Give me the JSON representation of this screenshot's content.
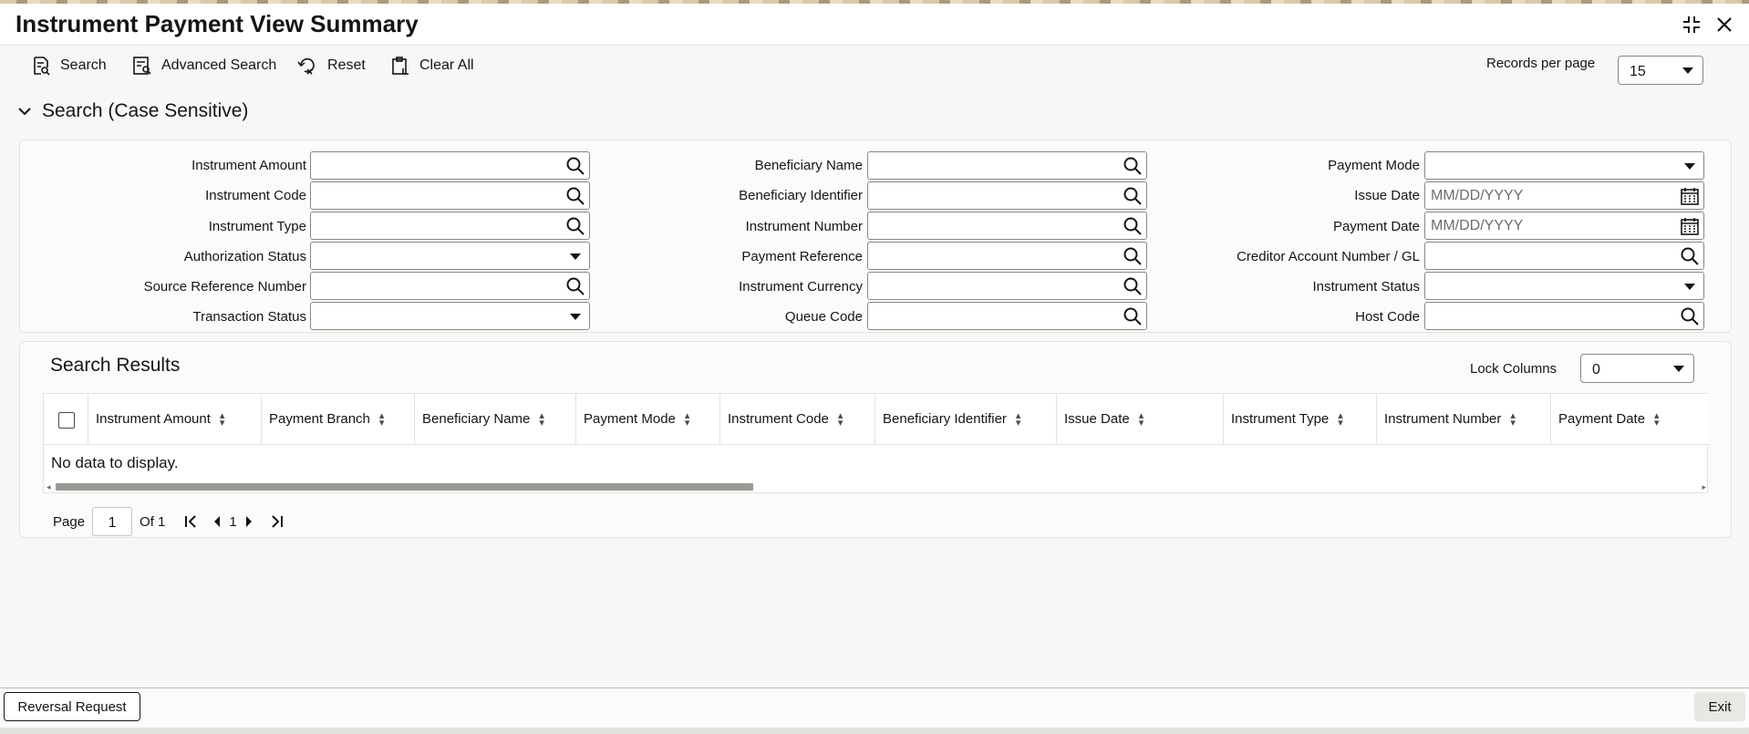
{
  "window": {
    "title": "Instrument Payment View Summary"
  },
  "toolbar": {
    "search": "Search",
    "advanced_search": "Advanced Search",
    "reset": "Reset",
    "clear_all": "Clear All",
    "records_per_page_label": "Records per page",
    "records_per_page_value": "15"
  },
  "search_section": {
    "title": "Search (Case Sensitive)",
    "fields": {
      "instrument_amount": "Instrument Amount",
      "instrument_code": "Instrument Code",
      "instrument_type": "Instrument Type",
      "authorization_status": "Authorization Status",
      "source_reference_number": "Source Reference Number",
      "transaction_status": "Transaction Status",
      "beneficiary_name": "Beneficiary Name",
      "beneficiary_identifier": "Beneficiary Identifier",
      "instrument_number": "Instrument Number",
      "payment_reference": "Payment Reference",
      "instrument_currency": "Instrument Currency",
      "queue_code": "Queue Code",
      "payment_mode": "Payment Mode",
      "issue_date": "Issue Date",
      "payment_date": "Payment Date",
      "creditor_account": "Creditor Account Number / GL",
      "instrument_status": "Instrument Status",
      "host_code": "Host Code"
    },
    "date_placeholder": "MM/DD/YYYY"
  },
  "results": {
    "title": "Search Results",
    "lock_columns_label": "Lock Columns",
    "lock_columns_value": "0",
    "columns": [
      "Instrument Amount",
      "Payment Branch",
      "Beneficiary Name",
      "Payment Mode",
      "Instrument Code",
      "Beneficiary Identifier",
      "Issue Date",
      "Instrument Type",
      "Instrument Number",
      "Payment Date"
    ],
    "empty_message": "No data to display."
  },
  "pager": {
    "page_label": "Page",
    "page_value": "1",
    "of_label": "Of 1",
    "current": "1"
  },
  "footer": {
    "reversal_request": "Reversal Request",
    "exit": "Exit"
  }
}
